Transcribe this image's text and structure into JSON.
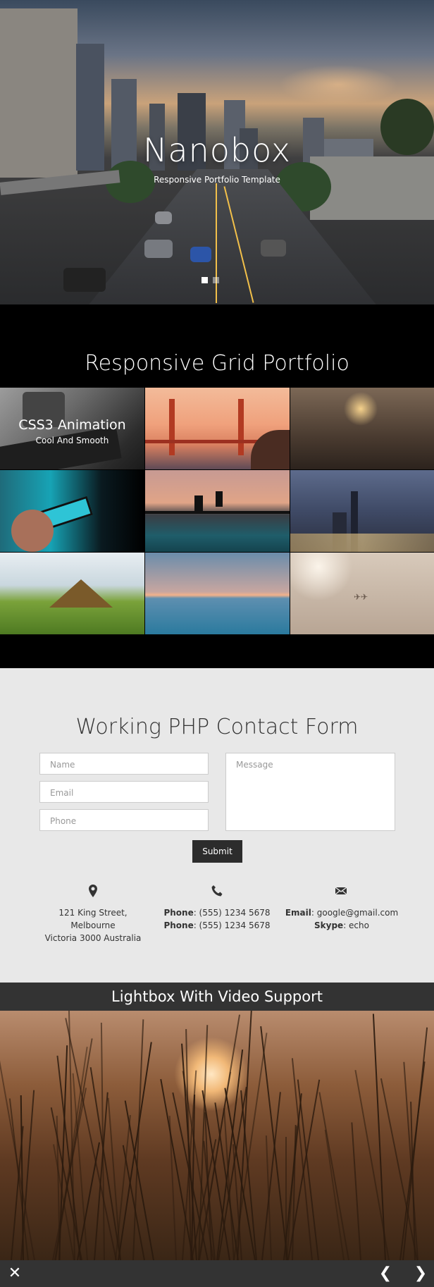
{
  "hero": {
    "title": "Nanobox",
    "subtitle": "Responsive Portfolio Template",
    "slides": 2
  },
  "portfolio": {
    "heading": "Responsive Grid Portfolio",
    "tiles": [
      {
        "caption": "CSS3 Animation",
        "subcaption": "Cool And Smooth",
        "theme": "keyboard-coffee"
      },
      {
        "theme": "golden-gate-bridge"
      },
      {
        "theme": "grass-sunset"
      },
      {
        "theme": "phone-hand"
      },
      {
        "theme": "infinity-pool-jump"
      },
      {
        "theme": "city-night"
      },
      {
        "theme": "tent-forest"
      },
      {
        "theme": "sea-horizon"
      },
      {
        "theme": "hazy-sky-jets"
      }
    ]
  },
  "contact": {
    "heading": "Working PHP Contact Form",
    "fields": {
      "name_placeholder": "Name",
      "email_placeholder": "Email",
      "phone_placeholder": "Phone",
      "message_placeholder": "Message"
    },
    "submit_label": "Submit",
    "address": {
      "line1": "121 King Street,",
      "line2": "Melbourne",
      "line3": "Victoria 3000 Australia"
    },
    "phones": [
      {
        "label": "Phone",
        "value": ": (555) 1234 5678"
      },
      {
        "label": "Phone",
        "value": ": (555) 1234 5678"
      }
    ],
    "email": {
      "label": "Email",
      "value": ": google@gmail.com"
    },
    "skype": {
      "label": "Skype",
      "value": ": echo"
    }
  },
  "lightbox": {
    "heading": "Lightbox With Video Support",
    "close_icon": "close-icon",
    "prev_icon": "chevron-left-icon",
    "next_icon": "chevron-right-icon"
  },
  "colors": {
    "dark_bar": "#333333",
    "contact_bg": "#e8e8e8",
    "submit_bg": "#2c2c2c"
  }
}
